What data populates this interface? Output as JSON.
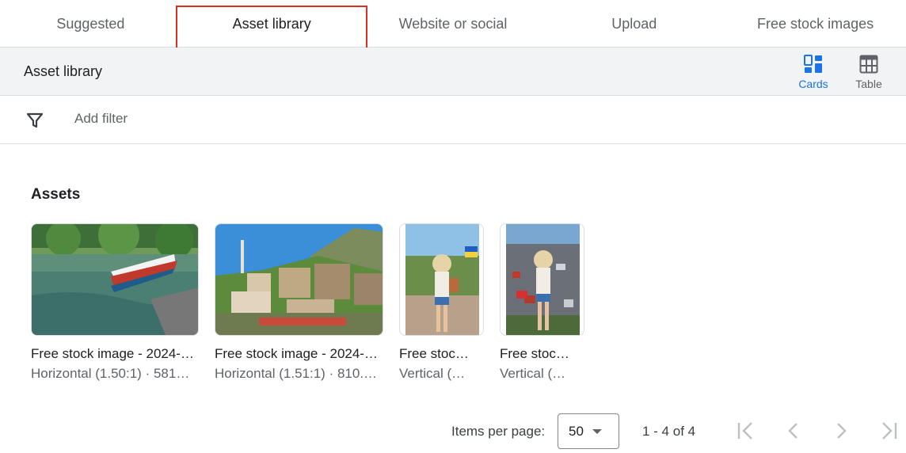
{
  "tabs": [
    {
      "label": "Suggested"
    },
    {
      "label": "Asset library"
    },
    {
      "label": "Website or social"
    },
    {
      "label": "Upload"
    },
    {
      "label": "Free stock images"
    }
  ],
  "header": {
    "title": "Asset library",
    "views": {
      "cards": "Cards",
      "table": "Table"
    }
  },
  "filter": {
    "placeholder": "Add filter"
  },
  "assets": {
    "title": "Assets",
    "items": [
      {
        "title": "Free stock image - 2024-…",
        "subtitle": "Horizontal (1.50:1) · 581…"
      },
      {
        "title": "Free stock image - 2024-…",
        "subtitle": "Horizontal (1.51:1) · 810.…"
      },
      {
        "title": "Free stoc…",
        "subtitle": "Vertical (…"
      },
      {
        "title": "Free stoc…",
        "subtitle": "Vertical (…"
      }
    ]
  },
  "pagination": {
    "items_per_page_label": "Items per page:",
    "items_per_page": "50",
    "range": "1 - 4 of 4"
  },
  "colors": {
    "accent": "#1a73e8",
    "highlight": "#d93025"
  },
  "icons": [
    "cards-view-icon",
    "table-view-icon",
    "filter-icon",
    "dropdown-caret-icon",
    "first-page-icon",
    "previous-page-icon",
    "next-page-icon",
    "last-page-icon"
  ]
}
